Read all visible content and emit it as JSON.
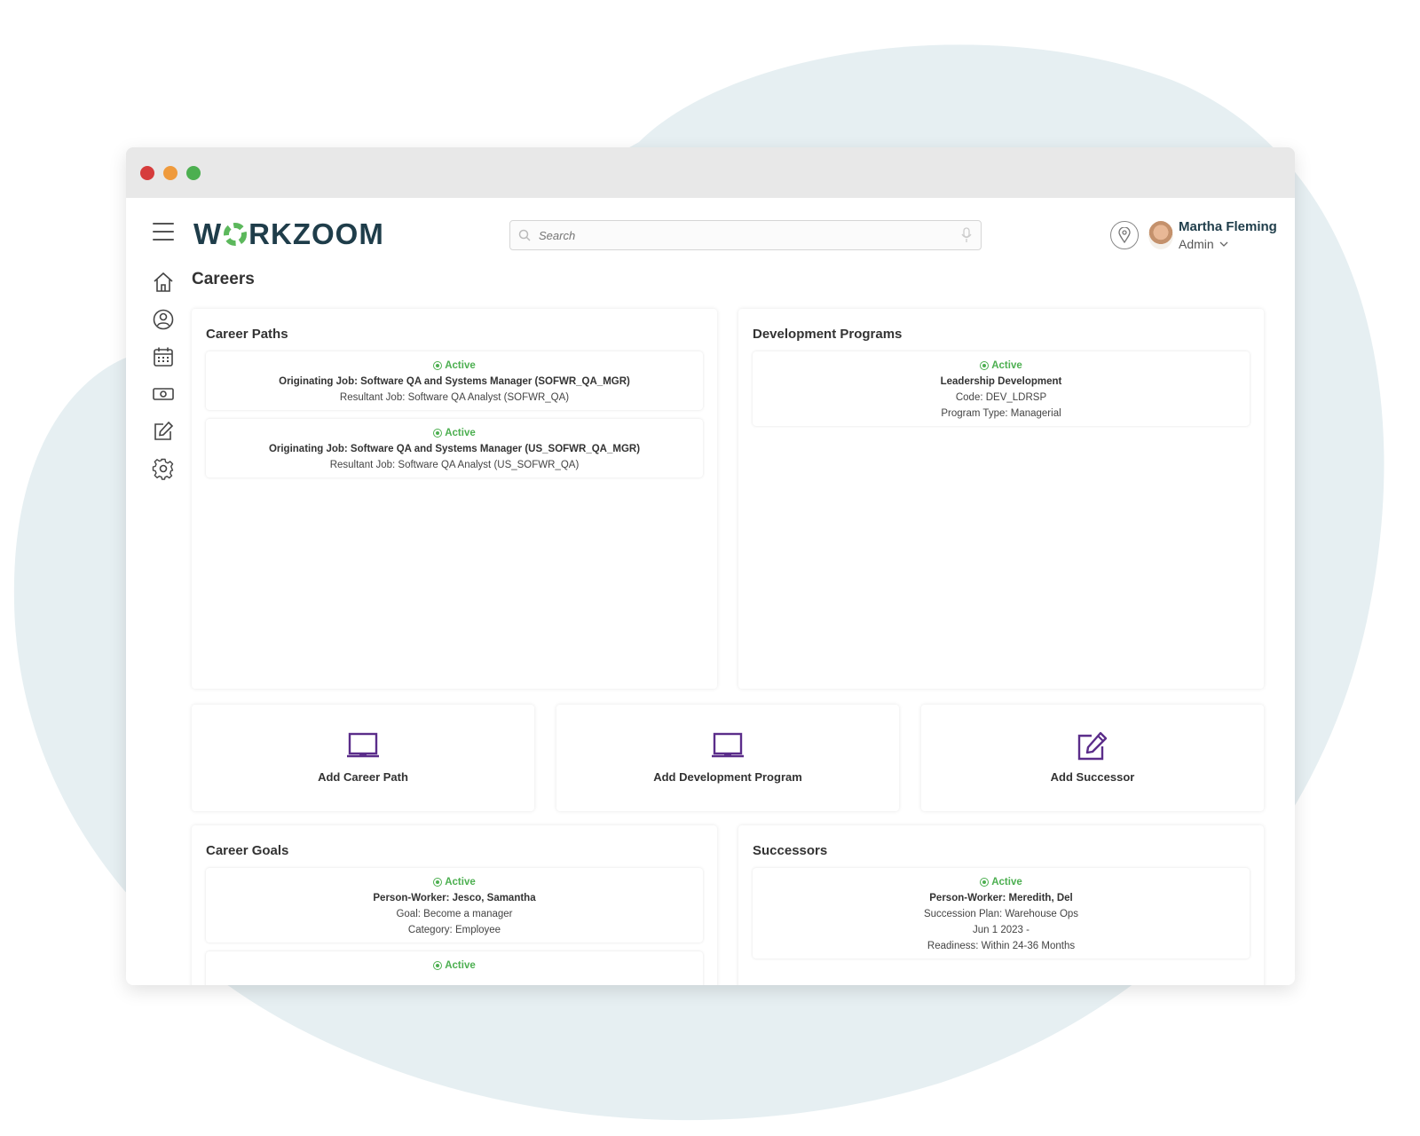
{
  "app": {
    "logo_text_left": "W",
    "logo_text_right": "RKZOOM",
    "search_placeholder": "Search",
    "user_name": "Martha Fleming",
    "user_role": "Admin"
  },
  "sidebar": {
    "items": [
      {
        "icon": "home-icon"
      },
      {
        "icon": "user-circle-icon"
      },
      {
        "icon": "calendar-icon"
      },
      {
        "icon": "money-icon"
      },
      {
        "icon": "edit-icon"
      },
      {
        "icon": "gear-icon"
      }
    ]
  },
  "page": {
    "title": "Careers"
  },
  "career_paths": {
    "title": "Career Paths",
    "items": [
      {
        "status": "Active",
        "line1": "Originating Job: Software QA and Systems Manager (SOFWR_QA_MGR)",
        "line2": "Resultant Job: Software QA Analyst (SOFWR_QA)"
      },
      {
        "status": "Active",
        "line1": "Originating Job: Software QA and Systems Manager (US_SOFWR_QA_MGR)",
        "line2": "Resultant Job: Software QA Analyst (US_SOFWR_QA)"
      }
    ]
  },
  "development_programs": {
    "title": "Development Programs",
    "items": [
      {
        "status": "Active",
        "line1": "Leadership Development",
        "line2": "Code: DEV_LDRSP",
        "line3": "Program Type: Managerial"
      }
    ]
  },
  "actions": {
    "add_career_path": "Add Career Path",
    "add_development_program": "Add Development Program",
    "add_successor": "Add Successor"
  },
  "career_goals": {
    "title": "Career Goals",
    "items": [
      {
        "status": "Active",
        "line1": "Person-Worker: Jesco, Samantha",
        "line2": "Goal: Become a manager",
        "line3": "Category: Employee"
      },
      {
        "status": "Active"
      }
    ]
  },
  "successors": {
    "title": "Successors",
    "items": [
      {
        "status": "Active",
        "line1": "Person-Worker: Meredith, Del",
        "line2": "Succession Plan: Warehouse Ops",
        "line3": "Jun 1 2023 -",
        "line4": "Readiness: Within 24-36 Months"
      }
    ]
  },
  "colors": {
    "accent_purple": "#5b2d8a",
    "active_green": "#4caf50",
    "logo_dark": "#1f3d4a",
    "background_blob": "#e8f0f3"
  }
}
